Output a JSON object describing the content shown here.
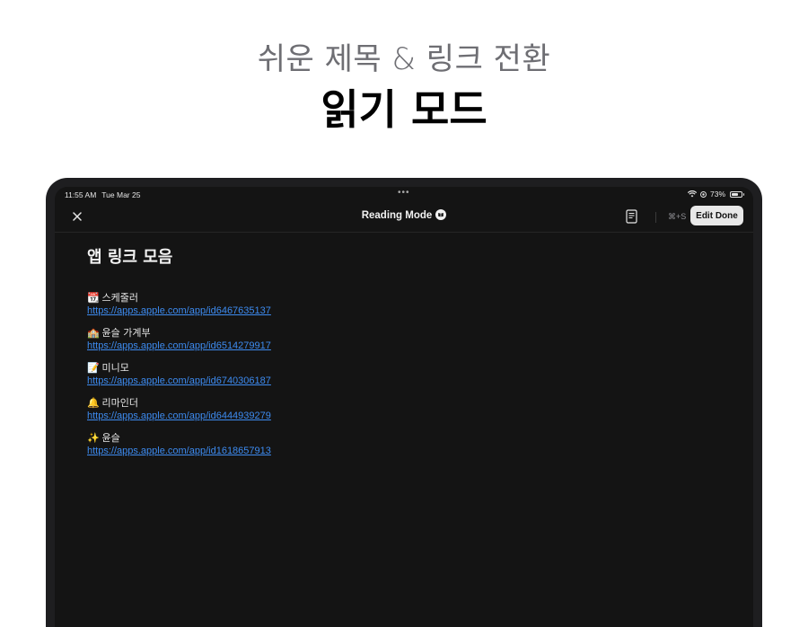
{
  "hero": {
    "subtitle": "쉬운 제목 & 링크 전환",
    "title": "읽기 모드"
  },
  "status_bar": {
    "time": "11:55 AM",
    "date": "Tue Mar 25",
    "multitask_indicator": "•••",
    "battery": "73%",
    "battery_level": 0.73
  },
  "nav": {
    "title": "Reading Mode",
    "shortcut": "⌘+S",
    "edit_done_label": "Edit Done"
  },
  "document": {
    "title": "앱 링크 모음",
    "items": [
      {
        "emoji": "📆",
        "label": "스케줄러",
        "url": "https://apps.apple.com/app/id6467635137"
      },
      {
        "emoji": "🏫",
        "label": "윤슬 가계부",
        "url": "https://apps.apple.com/app/id6514279917"
      },
      {
        "emoji": "📝",
        "label": "미니모",
        "url": "https://apps.apple.com/app/id6740306187"
      },
      {
        "emoji": "🔔",
        "label": "리마인더",
        "url": "https://apps.apple.com/app/id6444939279"
      },
      {
        "emoji": "✨",
        "label": "윤슬",
        "url": "https://apps.apple.com/app/id1618657913"
      }
    ]
  },
  "colors": {
    "link": "#3d8bf0",
    "screen_background": "#141414",
    "button_background": "#e8e8e8"
  }
}
